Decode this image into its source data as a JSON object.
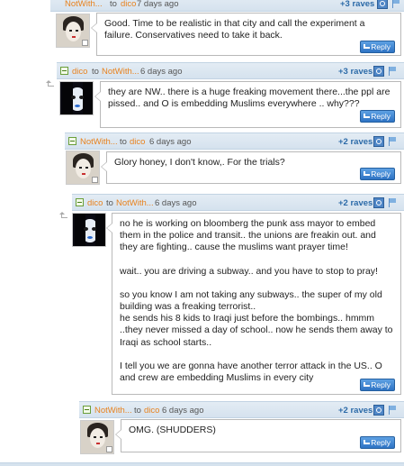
{
  "comments": [
    {
      "user": "NotWith...",
      "to_word": "to",
      "to_user": "dico",
      "ago": "7 days ago",
      "raves": "+3 raves",
      "avatar": "tiger",
      "paragraphs": [
        "Good. Time to be realistic in that city and call the experiment a failure. Conservatives need to take it back."
      ],
      "reply_label": "Reply"
    },
    {
      "user": "dico",
      "to_word": "to",
      "to_user": "NotWith...",
      "ago": "6 days ago",
      "raves": "+3 raves",
      "avatar": "dark",
      "paragraphs": [
        "they are NW.. there is a huge freaking movement there...the ppl are pissed.. and O is embedding Muslims everywhere .. why???"
      ],
      "reply_label": "Reply"
    },
    {
      "user": "NotWith...",
      "to_word": "to",
      "to_user": "dico",
      "ago": "6 days ago",
      "raves": "+2 raves",
      "avatar": "tiger",
      "paragraphs": [
        "Glory honey, I don't know,. For the trials?"
      ],
      "reply_label": "Reply"
    },
    {
      "user": "dico",
      "to_word": "to",
      "to_user": "NotWith...",
      "ago": "6 days ago",
      "raves": "+2 raves",
      "avatar": "dark",
      "paragraphs": [
        "no he is working on bloomberg the punk ass mayor to embed them in the police and transit.. the unions are freakin out. and they are fighting.. cause the muslims want prayer time!",
        "wait.. you are driving a subway.. and you have to stop to pray!",
        "so you know I am not taking any subways.. the super of my old building was a freaking terrorist..\nhe sends his 8 kids to Iraqi just before the bombings.. hmmm ..they never missed a day of school.. now he sends them away to Iraqi as school starts..",
        "I tell you we are gonna have another terror attack in the US.. O and crew are embedding Muslims in every city"
      ],
      "reply_label": "Reply"
    },
    {
      "user": "NotWith...",
      "to_word": "to",
      "to_user": "dico",
      "ago": "6 days ago",
      "raves": "+2 raves",
      "avatar": "tiger",
      "paragraphs": [
        "OMG. (SHUDDERS)"
      ],
      "reply_label": "Reply"
    }
  ]
}
